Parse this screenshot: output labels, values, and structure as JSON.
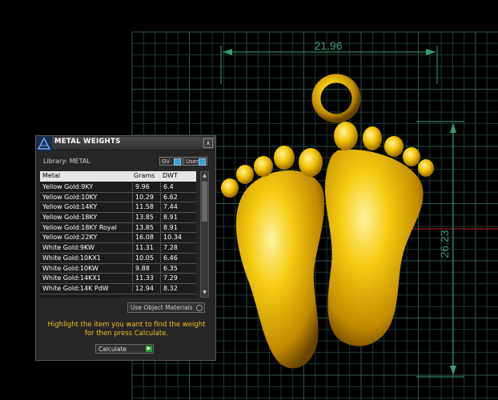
{
  "viewport": {
    "dimensions": {
      "width_label": "21.96",
      "height_label": "26.23"
    },
    "colors": {
      "grid": "#1e3a30",
      "major_grid": "#2f5a48",
      "dimension_line": "#38a070",
      "gold": "#f0c000",
      "red_axis": "#c02020"
    }
  },
  "panel": {
    "title": "METAL WEIGHTS",
    "close_glyph": "x",
    "library_label": "Library: METAL",
    "toggles": {
      "gv": "GV",
      "user": "User"
    },
    "columns": [
      "Metal",
      "Grams",
      "DWT"
    ],
    "rows": [
      {
        "metal": "Yellow Gold:9KY",
        "grams": "9.96",
        "dwt": "6.4"
      },
      {
        "metal": "Yellow Gold:10KY",
        "grams": "10.29",
        "dwt": "6.62"
      },
      {
        "metal": "Yellow Gold:14KY",
        "grams": "11.58",
        "dwt": "7.44"
      },
      {
        "metal": "Yellow Gold:18KY",
        "grams": "13.85",
        "dwt": "8.91"
      },
      {
        "metal": "Yellow Gold:18KY Royal",
        "grams": "13.85",
        "dwt": "8.91"
      },
      {
        "metal": "Yellow Gold:22KY",
        "grams": "16.08",
        "dwt": "10.34"
      },
      {
        "metal": "White Gold:9KW",
        "grams": "11.31",
        "dwt": "7.28"
      },
      {
        "metal": "White Gold:10KX1",
        "grams": "10.05",
        "dwt": "6.46"
      },
      {
        "metal": "White Gold:10KW",
        "grams": "9.88",
        "dwt": "6.35"
      },
      {
        "metal": "White Gold:14KX1",
        "grams": "11.33",
        "dwt": "7.29"
      },
      {
        "metal": "White Gold:14K PdW",
        "grams": "12.94",
        "dwt": "8.32"
      }
    ],
    "use_object_materials": "Use Object Materials",
    "instruction": "Highlight the item you want to find the weight for then press Calculate.",
    "calculate_label": "Calculate",
    "colors": {
      "instruction": "#f0c020",
      "toggle_indicator": "#3aa2c8"
    }
  }
}
